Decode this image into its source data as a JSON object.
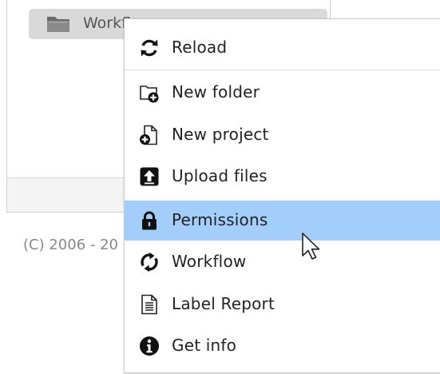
{
  "tree": {
    "folder_label": "Workflow"
  },
  "footer": {
    "copyright": "(C) 2006 - 20"
  },
  "context_menu": {
    "reload": "Reload",
    "new_folder": "New folder",
    "new_project": "New project",
    "upload_files": "Upload files",
    "permissions": "Permissions",
    "workflow": "Workflow",
    "label_report": "Label Report",
    "get_info": "Get info",
    "selected_item": "Permissions"
  },
  "colors": {
    "selection": "#a3cdfb",
    "folder_node": "#d9d9d9",
    "icon": "#111111"
  },
  "icons": {
    "reload": "reload-icon",
    "new_folder": "new-folder-icon",
    "new_project": "new-project-icon",
    "upload_files": "upload-icon",
    "permissions": "lock-icon",
    "workflow": "workflow-icon",
    "label_report": "report-icon",
    "get_info": "info-icon",
    "folder": "folder-icon",
    "cursor": "mouse-pointer-icon"
  }
}
